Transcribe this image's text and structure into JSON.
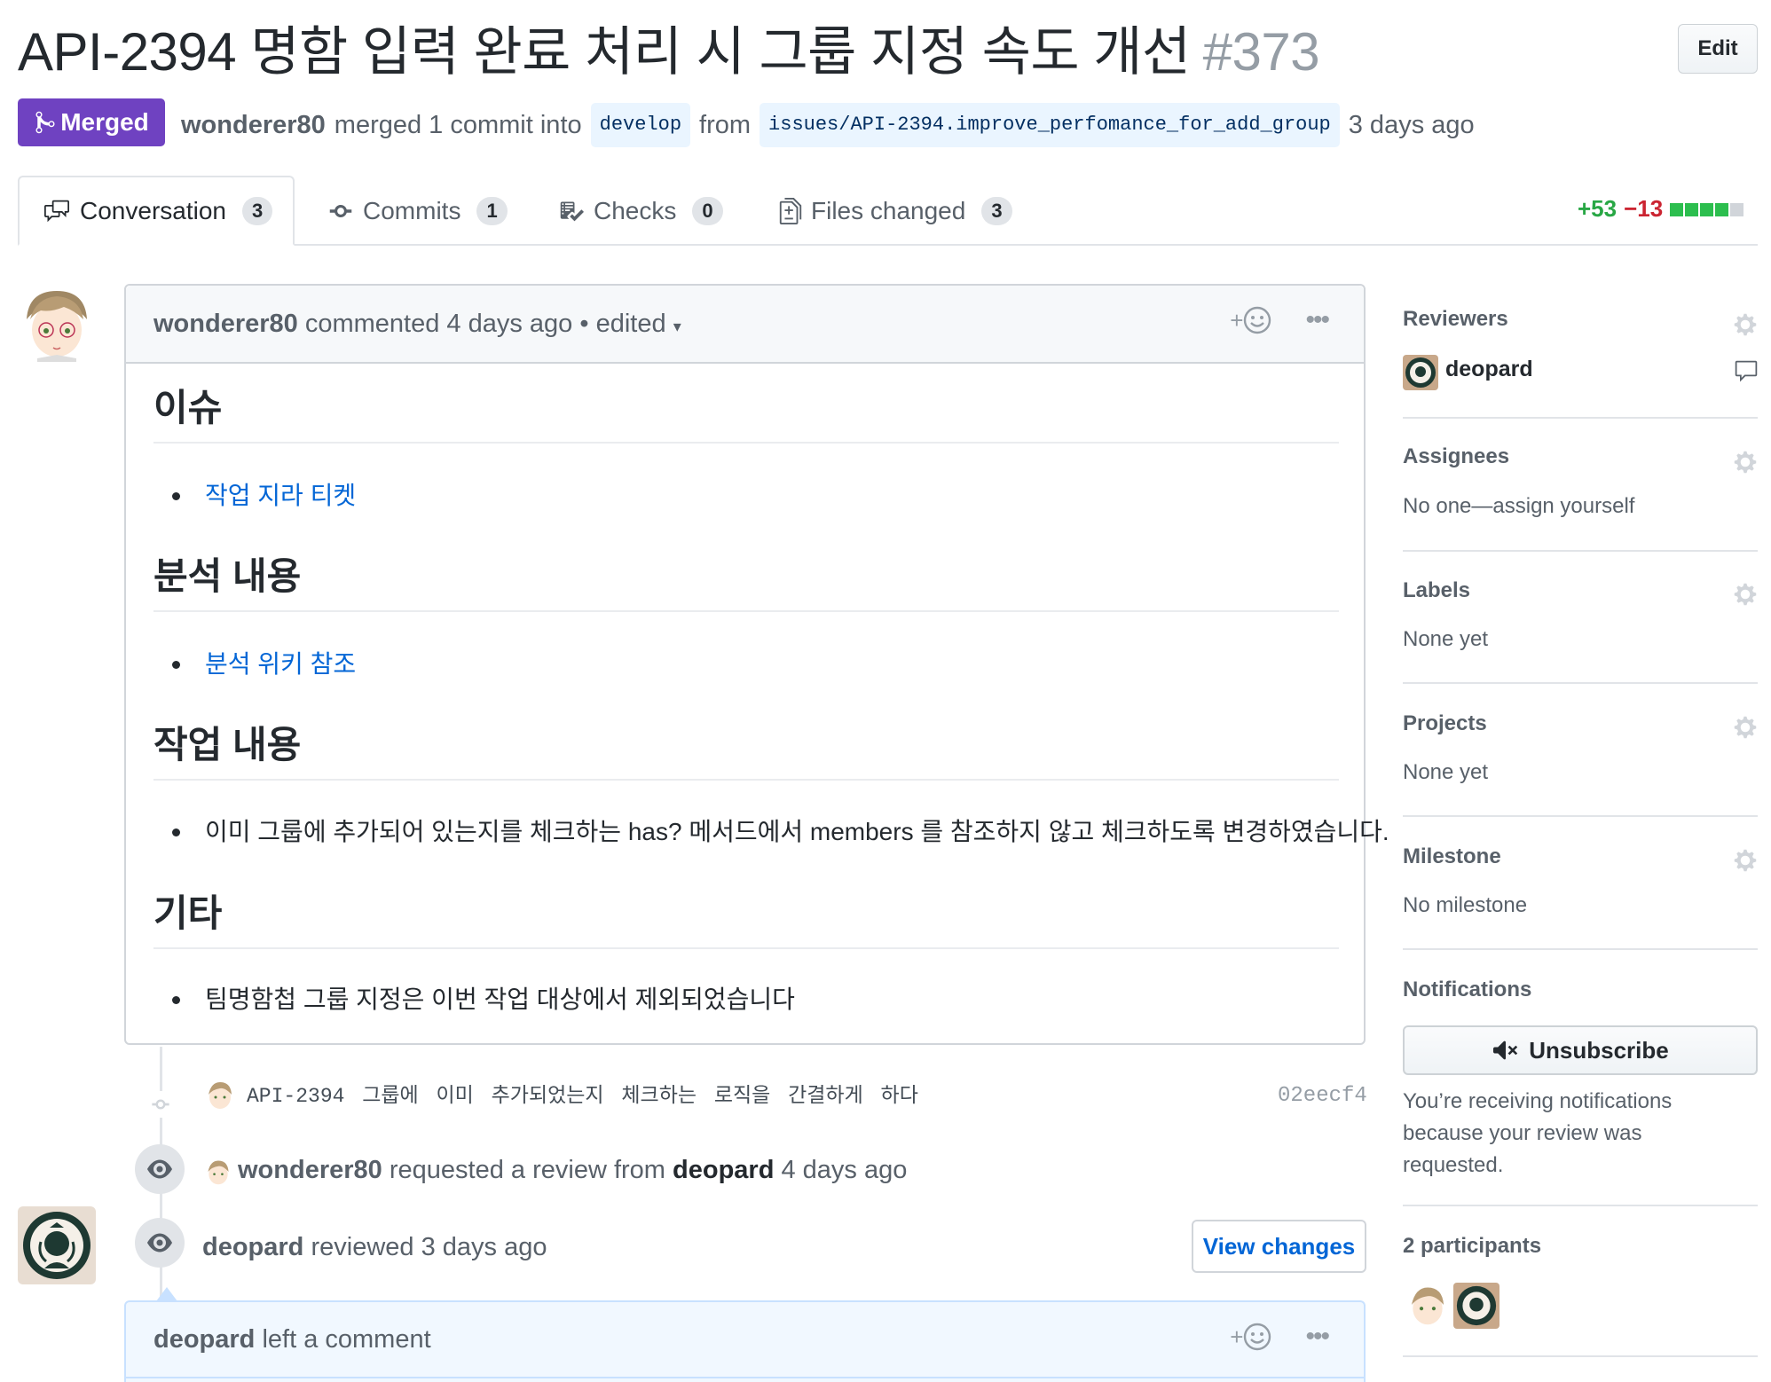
{
  "pr": {
    "title": "API-2394 명함 입력 완료 처리 시 그룹 지정 속도 개선",
    "number": "#373",
    "edit_label": "Edit",
    "state_label": "Merged",
    "author": "wonderer80",
    "merged_text": "merged 1 commit into",
    "base_branch": "develop",
    "from_text": "from",
    "head_branch": "issues/API-2394.improve_perfomance_for_add_group",
    "merged_time": "3 days ago"
  },
  "tabs": [
    {
      "label": "Conversation",
      "count": "3"
    },
    {
      "label": "Commits",
      "count": "1"
    },
    {
      "label": "Checks",
      "count": "0"
    },
    {
      "label": "Files changed",
      "count": "3"
    }
  ],
  "diffstat": {
    "additions": "+53",
    "deletions": "−13",
    "colors": [
      "#2cbe4e",
      "#2cbe4e",
      "#2cbe4e",
      "#2cbe4e",
      "#d1d5da"
    ]
  },
  "comment": {
    "author": "wonderer80",
    "action": "commented 4 days ago",
    "edited": "• edited",
    "sections": [
      {
        "heading": "이슈",
        "item": "작업 지라 티켓",
        "is_link": true
      },
      {
        "heading": "분석 내용",
        "item": "분석 위키 참조",
        "is_link": true
      },
      {
        "heading": "작업 내용",
        "item": "이미 그룹에 추가되어 있는지를 체크하는 has? 메서드에서 members 를 참조하지 않고 체크하도록 변경하였습니다.",
        "is_link": false
      },
      {
        "heading": "기타",
        "item": "팀명함첩 그룹 지정은 이번 작업 대상에서 제외되었습니다",
        "is_link": false
      }
    ]
  },
  "timeline": {
    "commit_message": "API-2394 그룹에 이미 추가되었는지 체크하는 로직을 간결하게 하다",
    "commit_sha": "02eecf4",
    "review_request": {
      "actor": "wonderer80",
      "text": "requested a review from",
      "reviewer": "deopard",
      "time": "4 days ago"
    },
    "review": {
      "actor": "deopard",
      "text": "reviewed 3 days ago",
      "button": "View changes"
    },
    "comment2": {
      "author": "deopard",
      "text": "left a comment"
    }
  },
  "sidebar": {
    "reviewers": {
      "title": "Reviewers",
      "name": "deopard"
    },
    "assignees": {
      "title": "Assignees",
      "text": "No one—assign yourself"
    },
    "labels": {
      "title": "Labels",
      "text": "None yet"
    },
    "projects": {
      "title": "Projects",
      "text": "None yet"
    },
    "milestone": {
      "title": "Milestone",
      "text": "No milestone"
    },
    "notifications": {
      "title": "Notifications",
      "button": "Unsubscribe",
      "line1": "You’re receiving notifications",
      "line2": "because your review was",
      "line3": "requested."
    },
    "participants": {
      "title": "2 participants"
    }
  }
}
